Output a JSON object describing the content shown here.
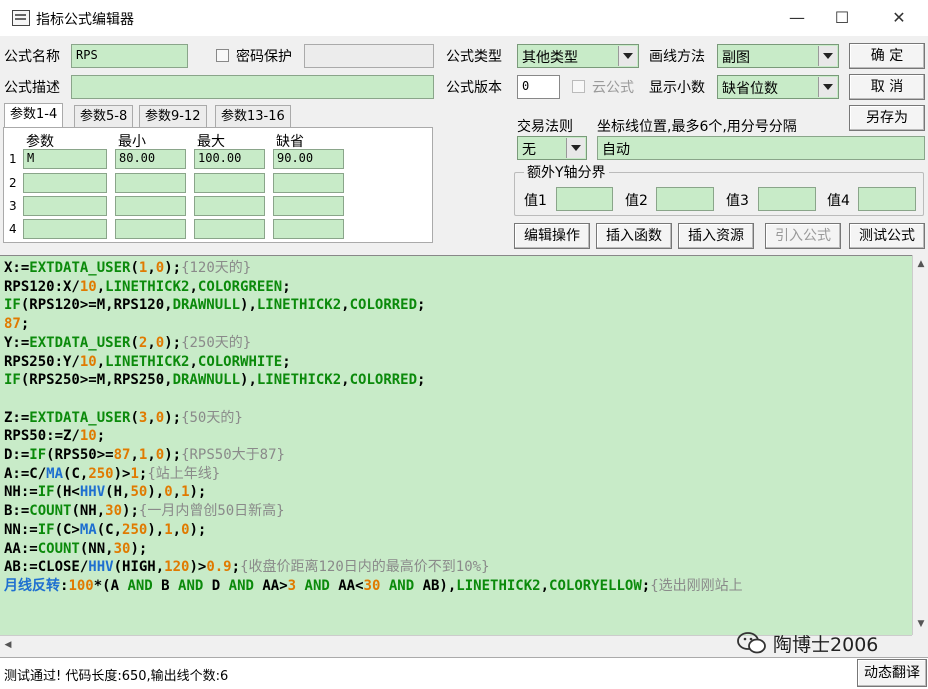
{
  "window": {
    "title": "指标公式编辑器",
    "minimize": "—",
    "maximize": "☐",
    "close": "✕"
  },
  "form": {
    "name_label": "公式名称",
    "name_value": "RPS",
    "password_label": "密码保护",
    "desc_label": "公式描述",
    "type_label": "公式类型",
    "type_value": "其他类型",
    "draw_label": "画线方法",
    "draw_value": "副图",
    "version_label": "公式版本",
    "version_value": "0",
    "cloud_label": "云公式",
    "decimal_label": "显示小数",
    "decimal_value": "缺省位数",
    "trade_label": "交易法则",
    "trade_value": "无",
    "coord_label": "坐标线位置,最多6个,用分号分隔",
    "coord_value": "自动",
    "extra_group": "额外Y轴分界",
    "values": [
      "值1",
      "值2",
      "值3",
      "值4"
    ]
  },
  "buttons": {
    "confirm": "确  定",
    "cancel": "取  消",
    "saveas": "另存为",
    "edit": "编辑操作",
    "insert_func": "插入函数",
    "insert_res": "插入资源",
    "import": "引入公式",
    "test": "测试公式",
    "translate": "动态翻译"
  },
  "tabs": [
    "参数1-4",
    "参数5-8",
    "参数9-12",
    "参数13-16"
  ],
  "params": {
    "headers": [
      "参数",
      "最小",
      "最大",
      "缺省"
    ],
    "rows": [
      {
        "idx": "1",
        "name": "M",
        "min": "80.00",
        "max": "100.00",
        "def": "90.00"
      },
      {
        "idx": "2",
        "name": "",
        "min": "",
        "max": "",
        "def": ""
      },
      {
        "idx": "3",
        "name": "",
        "min": "",
        "max": "",
        "def": ""
      },
      {
        "idx": "4",
        "name": "",
        "min": "",
        "max": "",
        "def": ""
      }
    ]
  },
  "code_lines": [
    [
      [
        "X:=",
        "k"
      ],
      [
        "EXTDATA_USER",
        "g"
      ],
      [
        "(",
        "k"
      ],
      [
        "1",
        "n"
      ],
      [
        ",",
        "k"
      ],
      [
        "0",
        "n"
      ],
      [
        ");",
        "k"
      ],
      [
        "{120天的}",
        "c"
      ]
    ],
    [
      [
        "RPS120:X/",
        "k"
      ],
      [
        "10",
        "n"
      ],
      [
        ",",
        "k"
      ],
      [
        "LINETHICK2",
        "g"
      ],
      [
        ",",
        "k"
      ],
      [
        "COLORGREEN",
        "g"
      ],
      [
        ";",
        "k"
      ]
    ],
    [
      [
        "IF",
        "g"
      ],
      [
        "(RPS120>=M,RPS120,",
        "k"
      ],
      [
        "DRAWNULL",
        "g"
      ],
      [
        "),",
        "k"
      ],
      [
        "LINETHICK2",
        "g"
      ],
      [
        ",",
        "k"
      ],
      [
        "COLORRED",
        "g"
      ],
      [
        ";",
        "k"
      ]
    ],
    [
      [
        "87",
        "n"
      ],
      [
        ";",
        "k"
      ]
    ],
    [
      [
        "Y:=",
        "k"
      ],
      [
        "EXTDATA_USER",
        "g"
      ],
      [
        "(",
        "k"
      ],
      [
        "2",
        "n"
      ],
      [
        ",",
        "k"
      ],
      [
        "0",
        "n"
      ],
      [
        ");",
        "k"
      ],
      [
        "{250天的}",
        "c"
      ]
    ],
    [
      [
        "RPS250:Y/",
        "k"
      ],
      [
        "10",
        "n"
      ],
      [
        ",",
        "k"
      ],
      [
        "LINETHICK2",
        "g"
      ],
      [
        ",",
        "k"
      ],
      [
        "COLORWHITE",
        "g"
      ],
      [
        ";",
        "k"
      ]
    ],
    [
      [
        "IF",
        "g"
      ],
      [
        "(RPS250>=M,RPS250,",
        "k"
      ],
      [
        "DRAWNULL",
        "g"
      ],
      [
        "),",
        "k"
      ],
      [
        "LINETHICK2",
        "g"
      ],
      [
        ",",
        "k"
      ],
      [
        "COLORRED",
        "g"
      ],
      [
        ";",
        "k"
      ]
    ],
    [],
    [
      [
        "Z:=",
        "k"
      ],
      [
        "EXTDATA_USER",
        "g"
      ],
      [
        "(",
        "k"
      ],
      [
        "3",
        "n"
      ],
      [
        ",",
        "k"
      ],
      [
        "0",
        "n"
      ],
      [
        ");",
        "k"
      ],
      [
        "{50天的}",
        "c"
      ]
    ],
    [
      [
        "RPS50:=Z/",
        "k"
      ],
      [
        "10",
        "n"
      ],
      [
        ";",
        "k"
      ]
    ],
    [
      [
        "D:=",
        "k"
      ],
      [
        "IF",
        "g"
      ],
      [
        "(RPS50>=",
        "k"
      ],
      [
        "87",
        "n"
      ],
      [
        ",",
        "k"
      ],
      [
        "1",
        "n"
      ],
      [
        ",",
        "k"
      ],
      [
        "0",
        "n"
      ],
      [
        ");",
        "k"
      ],
      [
        "{RPS50大于87}",
        "c"
      ]
    ],
    [
      [
        "A:=C/",
        "k"
      ],
      [
        "MA",
        "f"
      ],
      [
        "(C,",
        "k"
      ],
      [
        "250",
        "n"
      ],
      [
        ")>",
        "k"
      ],
      [
        "1",
        "n"
      ],
      [
        ";",
        "k"
      ],
      [
        "{站上年线}",
        "c"
      ]
    ],
    [
      [
        "NH:=",
        "k"
      ],
      [
        "IF",
        "g"
      ],
      [
        "(H<",
        "k"
      ],
      [
        "HHV",
        "f"
      ],
      [
        "(H,",
        "k"
      ],
      [
        "50",
        "n"
      ],
      [
        "),",
        "k"
      ],
      [
        "0",
        "n"
      ],
      [
        ",",
        "k"
      ],
      [
        "1",
        "n"
      ],
      [
        ");",
        "k"
      ]
    ],
    [
      [
        "B:=",
        "k"
      ],
      [
        "COUNT",
        "g"
      ],
      [
        "(NH,",
        "k"
      ],
      [
        "30",
        "n"
      ],
      [
        ");",
        "k"
      ],
      [
        "{一月内曾创50日新高}",
        "c"
      ]
    ],
    [
      [
        "NN:=",
        "k"
      ],
      [
        "IF",
        "g"
      ],
      [
        "(C>",
        "k"
      ],
      [
        "MA",
        "f"
      ],
      [
        "(C,",
        "k"
      ],
      [
        "250",
        "n"
      ],
      [
        "),",
        "k"
      ],
      [
        "1",
        "n"
      ],
      [
        ",",
        "k"
      ],
      [
        "0",
        "n"
      ],
      [
        ");",
        "k"
      ]
    ],
    [
      [
        "AA:=",
        "k"
      ],
      [
        "COUNT",
        "g"
      ],
      [
        "(NN,",
        "k"
      ],
      [
        "30",
        "n"
      ],
      [
        ");",
        "k"
      ]
    ],
    [
      [
        "AB:=CLOSE/",
        "k"
      ],
      [
        "HHV",
        "f"
      ],
      [
        "(HIGH,",
        "k"
      ],
      [
        "120",
        "n"
      ],
      [
        ")>",
        "k"
      ],
      [
        "0.9",
        "n"
      ],
      [
        ";",
        "k"
      ],
      [
        "{收盘价距离120日内的最高价不到10%}",
        "c"
      ]
    ],
    [
      [
        "月线反转",
        "f"
      ],
      [
        ":",
        "k"
      ],
      [
        "100",
        "n"
      ],
      [
        "*(A ",
        "k"
      ],
      [
        "AND",
        "g"
      ],
      [
        " B ",
        "k"
      ],
      [
        "AND",
        "g"
      ],
      [
        " D ",
        "k"
      ],
      [
        "AND",
        "g"
      ],
      [
        " AA>",
        "k"
      ],
      [
        "3",
        "n"
      ],
      [
        " ",
        "k"
      ],
      [
        "AND",
        "g"
      ],
      [
        " AA<",
        "k"
      ],
      [
        "30",
        "n"
      ],
      [
        " ",
        "k"
      ],
      [
        "AND",
        "g"
      ],
      [
        " AB),",
        "k"
      ],
      [
        "LINETHICK2",
        "g"
      ],
      [
        ",",
        "k"
      ],
      [
        "COLORYELLOW",
        "g"
      ],
      [
        ";",
        "k"
      ],
      [
        "{选出刚刚站上",
        "c"
      ]
    ]
  ],
  "status": "测试通过! 代码长度:650,输出线个数:6",
  "watermark": "陶博士2006"
}
